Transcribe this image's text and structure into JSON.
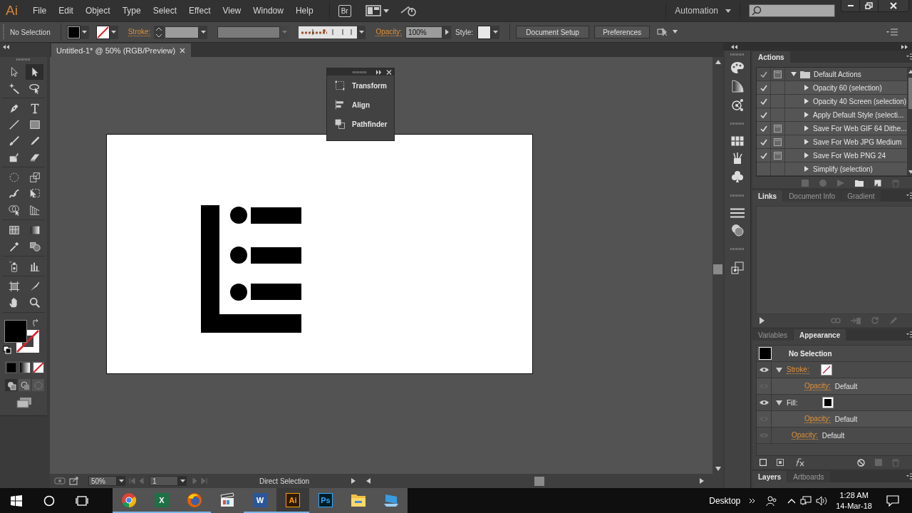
{
  "app": {
    "logo": "Ai",
    "menus": [
      "File",
      "Edit",
      "Object",
      "Type",
      "Select",
      "Effect",
      "View",
      "Window",
      "Help"
    ],
    "bridge": "Br",
    "workspace": "Automation"
  },
  "control_bar": {
    "selection": "No Selection",
    "stroke_label": "Stroke:",
    "opacity_label": "Opacity:",
    "opacity": "100%",
    "style_label": "Style:",
    "buttons": [
      "Document Setup",
      "Preferences"
    ]
  },
  "document_tab": {
    "title": "Untitled-1* @ 50% (RGB/Preview)",
    "selected": true
  },
  "tools": [
    {
      "kind": "selection",
      "selected": false
    },
    {
      "kind": "direct-selection",
      "selected": true
    },
    {
      "kind": "magic-wand",
      "selected": false
    },
    {
      "kind": "lasso",
      "selected": false
    },
    {
      "kind": "pen",
      "selected": false
    },
    {
      "kind": "type",
      "selected": false
    },
    {
      "kind": "line",
      "selected": false
    },
    {
      "kind": "rectangle",
      "selected": false
    },
    {
      "kind": "paintbrush",
      "selected": false
    },
    {
      "kind": "pencil",
      "selected": false
    },
    {
      "kind": "shaper",
      "selected": false
    },
    {
      "kind": "eraser",
      "selected": false
    },
    {
      "kind": "rotate",
      "selected": false
    },
    {
      "kind": "scale",
      "selected": false
    },
    {
      "kind": "width",
      "selected": false
    },
    {
      "kind": "free-transform",
      "selected": false
    },
    {
      "kind": "shape-builder",
      "selected": false
    },
    {
      "kind": "perspective",
      "selected": false
    },
    {
      "kind": "mesh",
      "selected": false
    },
    {
      "kind": "gradient",
      "selected": false
    },
    {
      "kind": "eyedropper",
      "selected": false
    },
    {
      "kind": "blend",
      "selected": false
    },
    {
      "kind": "symbol-sprayer",
      "selected": false
    },
    {
      "kind": "graph",
      "selected": false
    },
    {
      "kind": "artboard",
      "selected": false
    },
    {
      "kind": "slice",
      "selected": false
    },
    {
      "kind": "hand",
      "selected": false
    },
    {
      "kind": "zoom",
      "selected": false
    }
  ],
  "floating_panel": {
    "items": [
      {
        "kind": "transform",
        "label": "Transform"
      },
      {
        "kind": "align",
        "label": "Align"
      },
      {
        "kind": "pathfinder",
        "label": "Pathfinder"
      }
    ]
  },
  "status_bar": {
    "zoom": "50%",
    "artboard": "1",
    "tool": "Direct Selection"
  },
  "actions_panel": {
    "tabs": [
      {
        "label": "Actions",
        "selected": true
      }
    ],
    "rows": [
      {
        "kind": "set",
        "label": "Default Actions",
        "checked": true,
        "dialog": true,
        "expanded": true
      },
      {
        "kind": "action",
        "label": "Opacity 60 (selection)",
        "checked": true,
        "dialog": false,
        "expanded": false
      },
      {
        "kind": "action",
        "label": "Opacity 40 Screen (selection)",
        "checked": true,
        "dialog": false,
        "expanded": false
      },
      {
        "kind": "action",
        "label": "Apply Default Style (selecti...",
        "checked": true,
        "dialog": false,
        "expanded": false
      },
      {
        "kind": "action",
        "label": "Save For Web GIF 64 Dithe...",
        "checked": true,
        "dialog": true,
        "expanded": false
      },
      {
        "kind": "action",
        "label": "Save For Web JPG Medium",
        "checked": true,
        "dialog": true,
        "expanded": false
      },
      {
        "kind": "action",
        "label": "Save For Web PNG 24",
        "checked": true,
        "dialog": true,
        "expanded": false
      },
      {
        "kind": "action",
        "label": "Simplify (selection)",
        "checked": false,
        "dialog": false,
        "expanded": false
      }
    ]
  },
  "links_panel": {
    "tabs": [
      {
        "label": "Links",
        "selected": true
      },
      {
        "label": "Document Info",
        "selected": false
      },
      {
        "label": "Gradient",
        "selected": false
      }
    ]
  },
  "appearance_panel": {
    "tabs": [
      {
        "label": "Variables",
        "selected": false
      },
      {
        "label": "Appearance",
        "selected": true
      }
    ],
    "title": "No Selection",
    "rows": [
      {
        "kind": "stroke",
        "label": "Stroke:",
        "linked": true,
        "expanded": true,
        "children": [
          {
            "kind": "opacity",
            "label": "Opacity:",
            "value": "Default",
            "linked": true
          }
        ]
      },
      {
        "kind": "fill",
        "label": "Fill:",
        "linked": false,
        "expanded": true,
        "children": [
          {
            "kind": "opacity",
            "label": "Opacity:",
            "value": "Default",
            "linked": true
          }
        ]
      },
      {
        "kind": "opacity",
        "label": "Opacity:",
        "value": "Default",
        "linked": true
      }
    ]
  },
  "layers_panel": {
    "tabs": [
      {
        "label": "Layers",
        "selected": true
      },
      {
        "label": "Artboards",
        "selected": false
      }
    ]
  },
  "taskbar": {
    "apps": [
      {
        "kind": "chrome",
        "running": true,
        "selected": false
      },
      {
        "kind": "excel",
        "label": "X",
        "running": true,
        "selected": false
      },
      {
        "kind": "firefox",
        "running": true,
        "selected": false
      },
      {
        "kind": "video",
        "running": false,
        "selected": false
      },
      {
        "kind": "word",
        "label": "W",
        "running": true,
        "selected": false
      },
      {
        "kind": "illustrator",
        "label": "Ai",
        "running": true,
        "selected": true
      },
      {
        "kind": "photoshop",
        "label": "Ps",
        "running": false,
        "selected": false
      },
      {
        "kind": "explorer",
        "running": false,
        "selected": false
      },
      {
        "kind": "monitor",
        "running": false,
        "selected": false
      }
    ],
    "desktop": "Desktop",
    "time": "1:28 AM",
    "date": "14-Mar-18"
  }
}
